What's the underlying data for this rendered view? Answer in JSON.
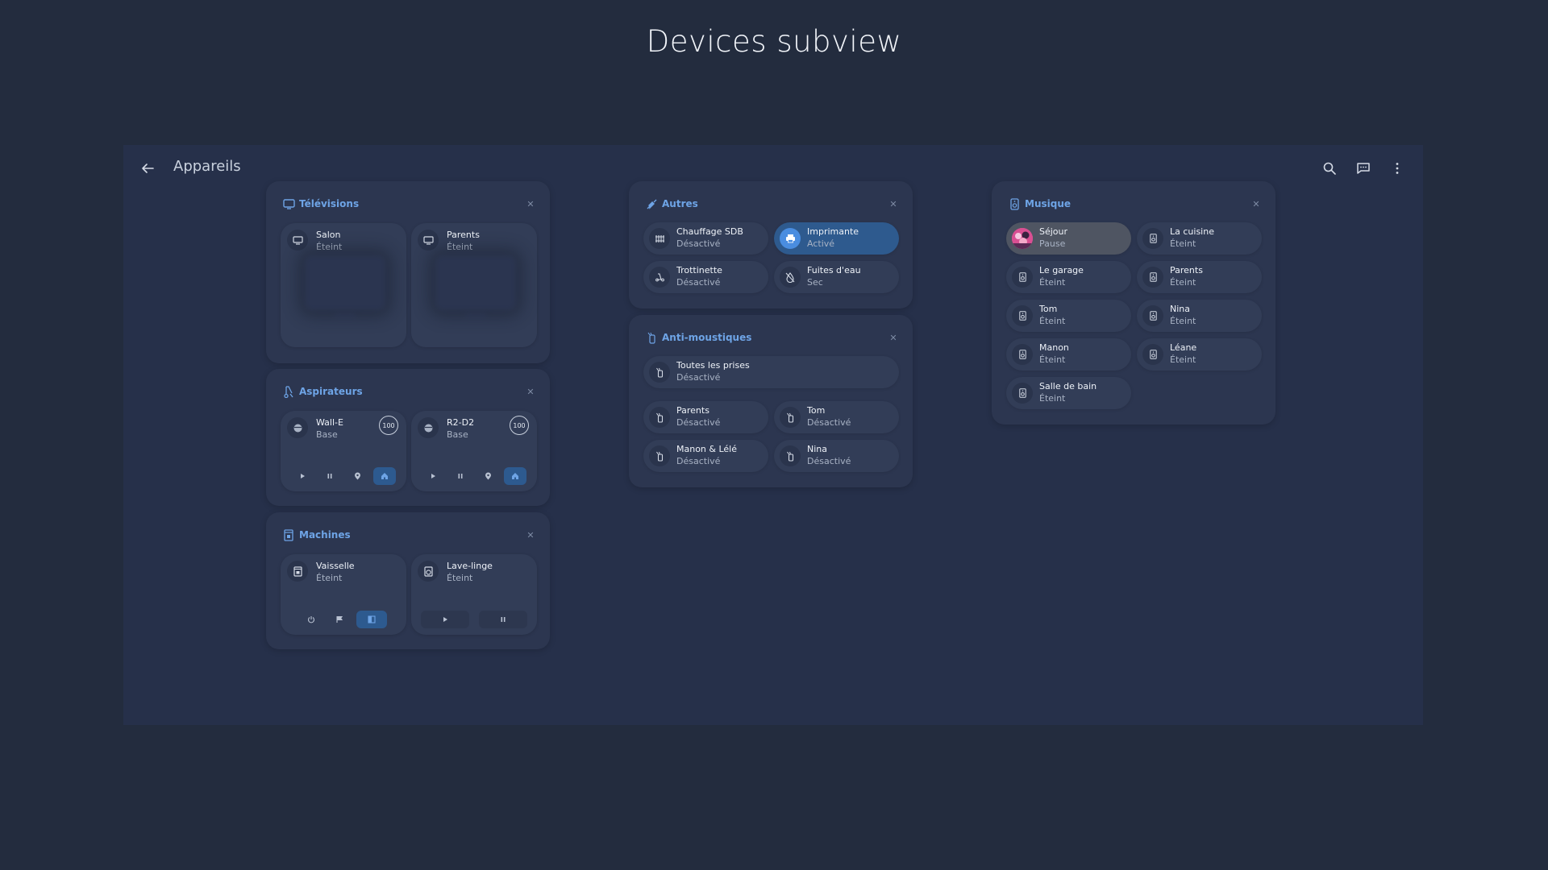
{
  "page_title": "Devices subview",
  "topbar": {
    "title": "Appareils",
    "icons": [
      "back-arrow-icon",
      "search-icon",
      "message-icon",
      "more-vertical-icon"
    ]
  },
  "colors": {
    "background": "#232c3e",
    "card": "#2c3650",
    "tile": "#323d57",
    "accent": "#6ea4e6",
    "active": "#2e5a8e"
  },
  "televisions": {
    "title": "Télévisions",
    "devices": [
      {
        "name": "Salon",
        "state": "Éteint"
      },
      {
        "name": "Parents",
        "state": "Éteint"
      }
    ]
  },
  "vacuums": {
    "title": "Aspirateurs",
    "devices": [
      {
        "name": "Wall-E",
        "state": "Base",
        "battery": "100"
      },
      {
        "name": "R2-D2",
        "state": "Base",
        "battery": "100"
      }
    ]
  },
  "machines": {
    "title": "Machines",
    "devices": [
      {
        "name": "Vaisselle",
        "state": "Éteint"
      },
      {
        "name": "Lave-linge",
        "state": "Éteint"
      }
    ]
  },
  "others": {
    "title": "Autres",
    "devices": [
      {
        "name": "Chauffage SDB",
        "state": "Désactivé"
      },
      {
        "name": "Imprimante",
        "state": "Activé"
      },
      {
        "name": "Trottinette",
        "state": "Désactivé"
      },
      {
        "name": "Fuites d'eau",
        "state": "Sec"
      }
    ]
  },
  "mosquito": {
    "title": "Anti-moustiques",
    "all": {
      "name": "Toutes les prises",
      "state": "Désactivé"
    },
    "devices": [
      {
        "name": "Parents",
        "state": "Désactivé"
      },
      {
        "name": "Tom",
        "state": "Désactivé"
      },
      {
        "name": "Manon & Lélé",
        "state": "Désactivé"
      },
      {
        "name": "Nina",
        "state": "Désactivé"
      }
    ]
  },
  "music": {
    "title": "Musique",
    "devices": [
      {
        "name": "Séjour",
        "state": "Pause"
      },
      {
        "name": "La cuisine",
        "state": "Éteint"
      },
      {
        "name": "Le garage",
        "state": "Éteint"
      },
      {
        "name": "Parents",
        "state": "Éteint"
      },
      {
        "name": "Tom",
        "state": "Éteint"
      },
      {
        "name": "Nina",
        "state": "Éteint"
      },
      {
        "name": "Manon",
        "state": "Éteint"
      },
      {
        "name": "Léane",
        "state": "Éteint"
      },
      {
        "name": "Salle de bain",
        "state": "Éteint"
      }
    ]
  }
}
